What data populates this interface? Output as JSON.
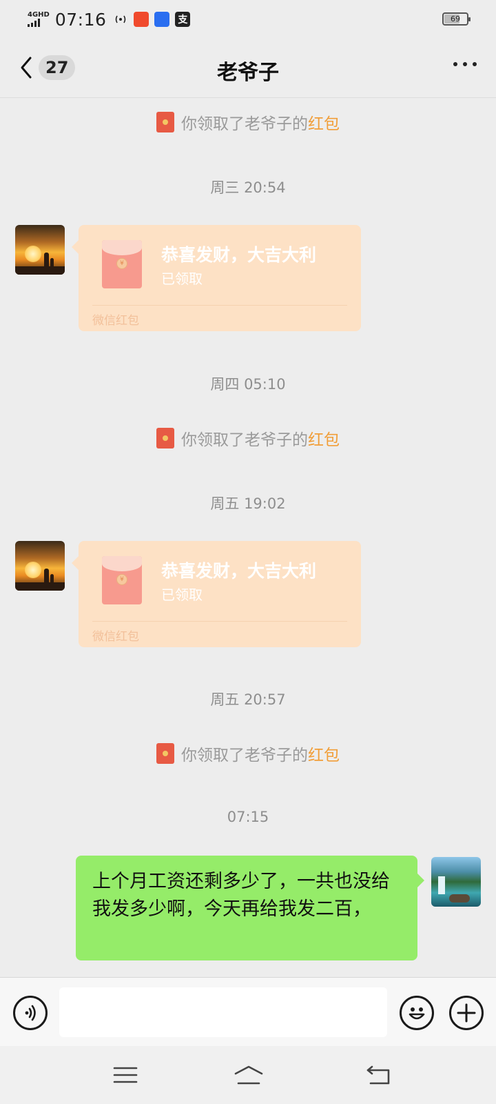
{
  "status_bar": {
    "network": "4GHD",
    "time": "07:16",
    "battery": "69",
    "icons": [
      "hotspot-icon",
      "app-notification-icon",
      "app-notification-icon",
      "alipay-icon"
    ],
    "app3_glyph": "支"
  },
  "header": {
    "unread_count": "27",
    "title": "老爷子"
  },
  "messages": {
    "sys1": {
      "prefix": "你领取了老爷子的",
      "highlight": "红包"
    },
    "time1": "周三 20:54",
    "rp1": {
      "title": "恭喜发财，大吉大利",
      "status": "已领取",
      "footer": "微信红包",
      "coin": "¥"
    },
    "time2": "周四 05:10",
    "sys2": {
      "prefix": "你领取了老爷子的",
      "highlight": "红包"
    },
    "time3": "周五 19:02",
    "rp2": {
      "title": "恭喜发财，大吉大利",
      "status": "已领取",
      "footer": "微信红包",
      "coin": "¥"
    },
    "time4": "周五 20:57",
    "sys3": {
      "prefix": "你领取了老爷子的",
      "highlight": "红包"
    },
    "time5": "07:15",
    "outgoing": "上个月工资还剩多少了，一共也没给我发多少啊，今天再给我发二百，"
  },
  "input": {
    "value": "",
    "placeholder": ""
  },
  "colors": {
    "accent_highlight": "#f19e38",
    "bubble_green": "#95ec69",
    "red_packet": "#fde1c5",
    "background": "#ededed"
  }
}
